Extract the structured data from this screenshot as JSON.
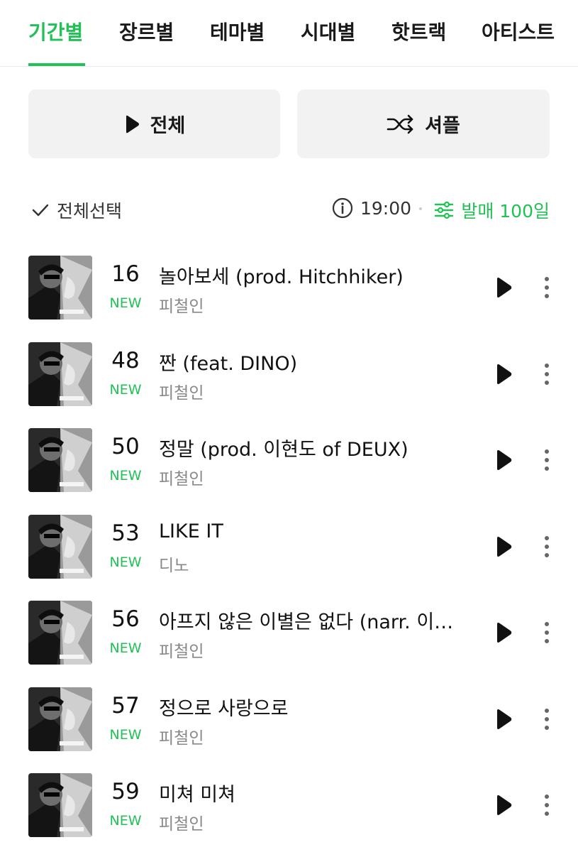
{
  "tabs": [
    {
      "label": "기간별",
      "active": true
    },
    {
      "label": "장르별"
    },
    {
      "label": "테마별"
    },
    {
      "label": "시대별"
    },
    {
      "label": "핫트랙"
    },
    {
      "label": "아티스트"
    }
  ],
  "buttons": {
    "play_all_label": "전체",
    "shuffle_label": "셔플"
  },
  "toolbar": {
    "select_all_label": "전체선택",
    "time": "19:00",
    "filter_label": "발매 100일"
  },
  "tracks": [
    {
      "rank": "16",
      "badge": "NEW",
      "title": "놀아보세 (prod. Hitchhiker)",
      "artist": "피철인"
    },
    {
      "rank": "48",
      "badge": "NEW",
      "title": "짠 (feat. DINO)",
      "artist": "피철인"
    },
    {
      "rank": "50",
      "badge": "NEW",
      "title": "정말 (prod. 이현도 of DEUX)",
      "artist": "피철인"
    },
    {
      "rank": "53",
      "badge": "NEW",
      "title": "LIKE IT",
      "artist": "디노"
    },
    {
      "rank": "56",
      "badge": "NEW",
      "title": "아프지 않은 이별은 없다 (narr. 이…",
      "artist": "피철인"
    },
    {
      "rank": "57",
      "badge": "NEW",
      "title": "정으로 사랑으로",
      "artist": "피철인"
    },
    {
      "rank": "59",
      "badge": "NEW",
      "title": "미쳐 미쳐",
      "artist": "피철인"
    }
  ],
  "colors": {
    "accent": "#20c155",
    "button_bg": "#f2f2f2",
    "secondary_text": "#888888"
  },
  "icons": [
    "play-icon",
    "shuffle-icon",
    "check-icon",
    "info-icon",
    "sliders-icon",
    "more-vertical-icon"
  ]
}
